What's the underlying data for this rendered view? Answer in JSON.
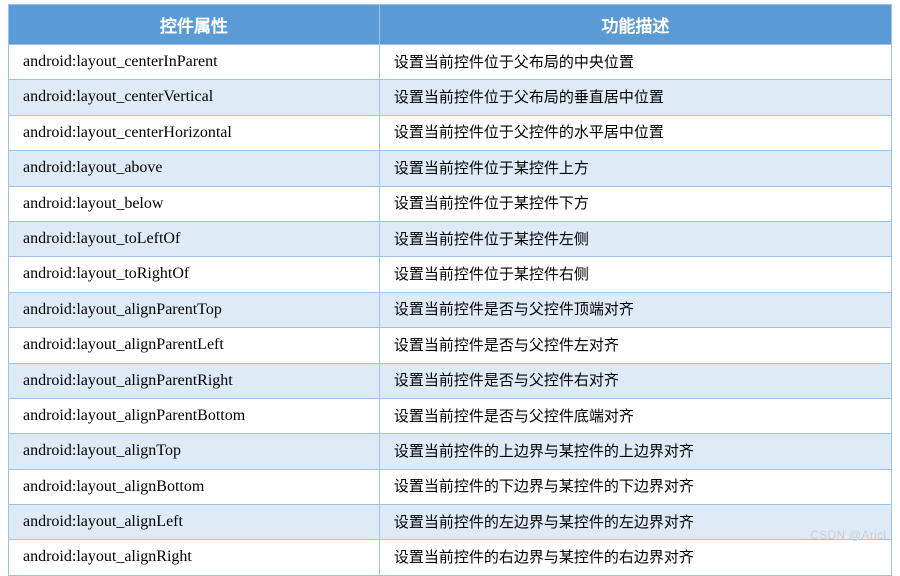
{
  "table": {
    "headers": {
      "attr": "控件属性",
      "desc": "功能描述"
    },
    "rows": [
      {
        "attr": "android:layout_centerInParent",
        "desc": "设置当前控件位于父布局的中央位置"
      },
      {
        "attr": "android:layout_centerVertical",
        "desc": "设置当前控件位于父布局的垂直居中位置"
      },
      {
        "attr": "android:layout_centerHorizontal",
        "desc": "设置当前控件位于父控件的水平居中位置"
      },
      {
        "attr": "android:layout_above",
        "desc": "设置当前控件位于某控件上方"
      },
      {
        "attr": "android:layout_below",
        "desc": "设置当前控件位于某控件下方"
      },
      {
        "attr": "android:layout_toLeftOf",
        "desc": "设置当前控件位于某控件左侧"
      },
      {
        "attr": "android:layout_toRightOf",
        "desc": "设置当前控件位于某控件右侧"
      },
      {
        "attr": "android:layout_alignParentTop",
        "desc": "设置当前控件是否与父控件顶端对齐"
      },
      {
        "attr": "android:layout_alignParentLeft",
        "desc": "设置当前控件是否与父控件左对齐"
      },
      {
        "attr": "android:layout_alignParentRight",
        "desc": "设置当前控件是否与父控件右对齐"
      },
      {
        "attr": "android:layout_alignParentBottom",
        "desc": "设置当前控件是否与父控件底端对齐"
      },
      {
        "attr": "android:layout_alignTop",
        "desc": "设置当前控件的上边界与某控件的上边界对齐"
      },
      {
        "attr": "android:layout_alignBottom",
        "desc": "设置当前控件的下边界与某控件的下边界对齐"
      },
      {
        "attr": "android:layout_alignLeft",
        "desc": "设置当前控件的左边界与某控件的左边界对齐"
      },
      {
        "attr": "android:layout_alignRight",
        "desc": "设置当前控件的右边界与某控件的右边界对齐"
      }
    ]
  },
  "watermark": "CSDN @Aricl."
}
